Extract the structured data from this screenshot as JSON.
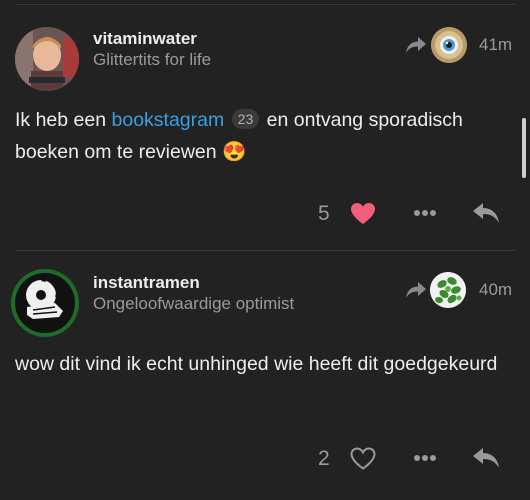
{
  "posts": [
    {
      "username": "vitaminwater",
      "user_title": "Glittertits for life",
      "timestamp": "41m",
      "body_prefix": "Ik heb een ",
      "link_text": "bookstagram",
      "link_count": "23",
      "body_suffix": " en ontvang sporadisch boeken om te reviewen",
      "emoji": "😍",
      "like_count": "5",
      "liked": true,
      "reply_to_avatar": "eye-avatar"
    },
    {
      "username": "instantramen",
      "user_title": "Ongeloofwaardige optimist",
      "timestamp": "40m",
      "body": "wow dit vind ik echt unhinged wie heeft dit goedgekeurd",
      "like_count": "2",
      "liked": false,
      "reply_to_avatar": "plant-avatar"
    }
  ],
  "colors": {
    "background": "#222222",
    "link": "#3aa0e0",
    "heart_liked": "#f0607a",
    "muted": "#9a9a9a"
  }
}
